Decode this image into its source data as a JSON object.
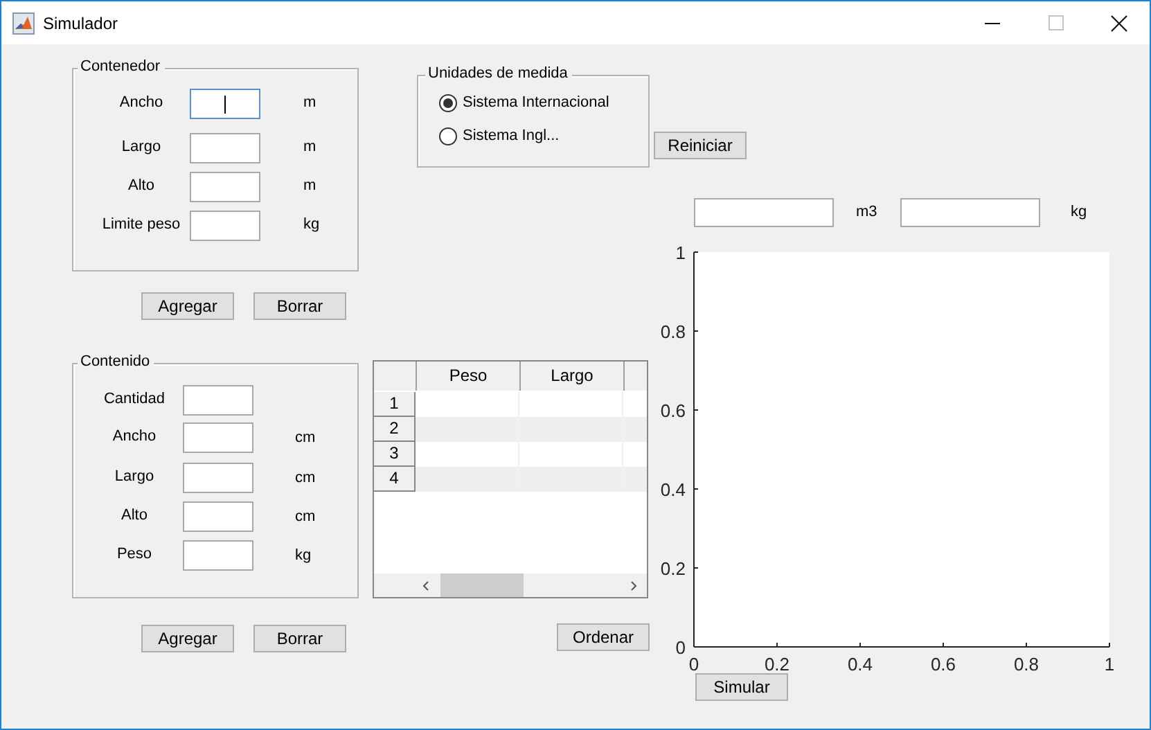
{
  "window": {
    "title": "Simulador"
  },
  "container_panel": {
    "title": "Contenedor",
    "fields": [
      {
        "label": "Ancho",
        "unit": "m",
        "focused": true
      },
      {
        "label": "Largo",
        "unit": "m",
        "focused": false
      },
      {
        "label": "Alto",
        "unit": "m",
        "focused": false
      },
      {
        "label": "Limite peso",
        "unit": "kg",
        "focused": false
      }
    ],
    "buttons": [
      "Agregar",
      "Borrar"
    ]
  },
  "units": {
    "title": "Unidades de medida",
    "options": [
      {
        "label": "Sistema Internacional",
        "selected": true
      },
      {
        "label": "Sistema Ingl...",
        "selected": false
      }
    ]
  },
  "reset_button": "Reiniciar",
  "totals": [
    {
      "unit": "m3"
    },
    {
      "unit": "kg"
    }
  ],
  "content_panel": {
    "title": "Contenido",
    "fields": [
      {
        "label": "Cantidad"
      },
      {
        "label": "Ancho",
        "unit": "cm"
      },
      {
        "label": "Largo",
        "unit": "cm"
      },
      {
        "label": "Alto",
        "unit": "cm"
      },
      {
        "label": "Peso",
        "unit": "kg"
      }
    ],
    "buttons": [
      "Agregar",
      "Borrar"
    ]
  },
  "table": {
    "columns": [
      "Peso",
      "Largo"
    ],
    "rows": [
      "1",
      "2",
      "3",
      "4"
    ]
  },
  "sort_button": "Ordenar",
  "chart": {
    "chart_data": {
      "type": "line",
      "xlim": [
        0,
        1
      ],
      "ylim": [
        0,
        1
      ],
      "xticks": [
        0,
        0.2,
        0.4,
        0.6,
        0.8,
        1
      ],
      "yticks": [
        0,
        0.2,
        0.4,
        0.6,
        0.8,
        1
      ]
    }
  },
  "simulate_button": "Simular"
}
